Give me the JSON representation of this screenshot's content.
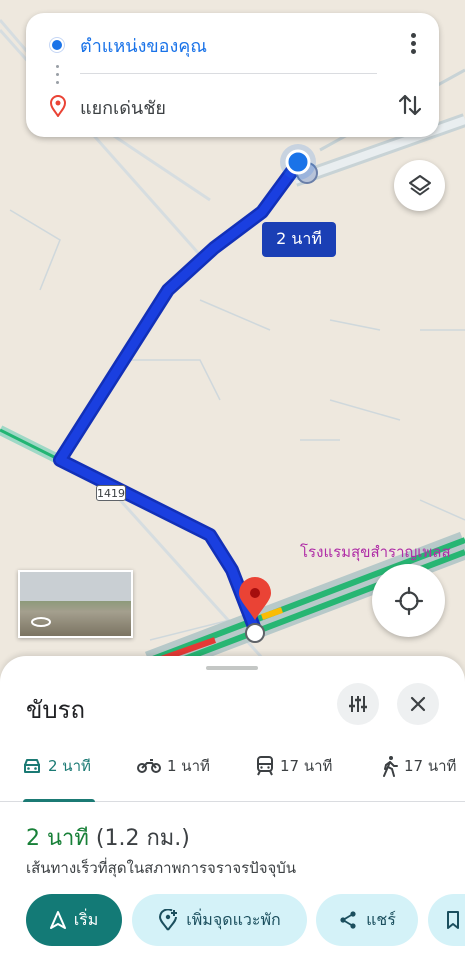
{
  "search": {
    "origin": "ตำแหน่งของคุณ",
    "destination": "แยกเด่นชัย"
  },
  "map": {
    "route_time": "2 นาที",
    "road_number": "1419",
    "poi_label": "โรงแรมสุขสำราญเพลส",
    "route_color": "#1a3fe0"
  },
  "sheet": {
    "title": "ขับรถ",
    "tabs": [
      {
        "mode": "car-icon",
        "label": "2 นาที"
      },
      {
        "mode": "motorcycle-icon",
        "label": "1 นาที"
      },
      {
        "mode": "transit-icon",
        "label": "17 นาที"
      },
      {
        "mode": "walk-icon",
        "label": "17 นาที"
      }
    ],
    "duration": "2 นาที",
    "distance": "(1.2 กม.)",
    "description": "เส้นทางเร็วที่สุดในสภาพการจราจรปัจจุบัน",
    "buttons": {
      "start": "เริ่ม",
      "add_stop": "เพิ่มจุดแวะพัก",
      "share": "แชร์"
    }
  },
  "colors": {
    "accent": "#137a76",
    "route": "#1a3fe0",
    "duration": "#188038"
  }
}
